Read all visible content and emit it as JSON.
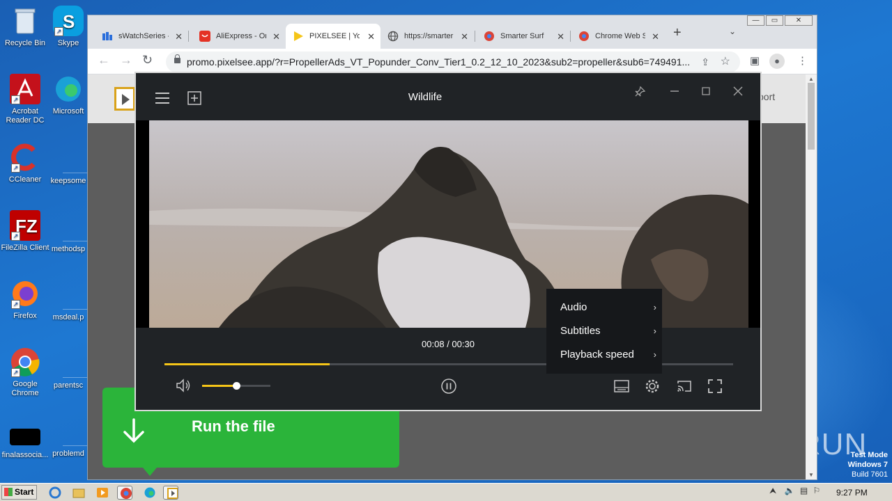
{
  "desktop": {
    "icons": [
      {
        "label": "Recycle Bin"
      },
      {
        "label": "Skype"
      },
      {
        "label": "Acrobat Reader DC"
      },
      {
        "label": "Microsoft"
      },
      {
        "label": "CCleaner"
      },
      {
        "label": "keepsome"
      },
      {
        "label": "FileZilla Client"
      },
      {
        "label": "methodsp"
      },
      {
        "label": "Firefox"
      },
      {
        "label": "msdeal.p"
      },
      {
        "label": "Google Chrome"
      },
      {
        "label": "parentsc"
      },
      {
        "label": "finalassocia..."
      },
      {
        "label": "problemd"
      }
    ],
    "watermark": "ANY RUN",
    "test_mode": [
      "Test Mode",
      "Windows 7",
      "Build 7601"
    ]
  },
  "browser": {
    "window_controls": {
      "minimize": "—",
      "restore": "▭",
      "close": "✕"
    },
    "tabs": [
      {
        "title": "sWatchSeries -",
        "close": "✕"
      },
      {
        "title": "AliExpress - On",
        "close": "✕"
      },
      {
        "title": "PIXELSEE | You",
        "close": "✕"
      },
      {
        "title": "https://smarter",
        "close": "✕"
      },
      {
        "title": "Smarter Surf",
        "close": "✕"
      },
      {
        "title": "Chrome Web S",
        "close": "✕"
      }
    ],
    "new_tab": "+",
    "tab_dropdown": "⌄",
    "nav": {
      "back": "←",
      "forward": "→",
      "reload": "↻"
    },
    "url": "promo.pixelsee.app/?r=PropellerAds_VT_Popunder_Conv_Tier1_0.2_12_10_2023&sub2=propeller&sub6=749491...",
    "page_header_link": "port"
  },
  "player": {
    "title": "Wildlife",
    "current_time": "00:08",
    "duration": "00:30",
    "time_display": "00:08 / 00:30",
    "progress_fraction": 0.29,
    "volume_fraction": 0.5,
    "settings_menu": [
      {
        "label": "Audio",
        "arrow": "›"
      },
      {
        "label": "Subtitles",
        "arrow": "›"
      },
      {
        "label": "Playback speed",
        "arrow": "›"
      }
    ]
  },
  "overlay": {
    "run_button_label": "Run the file"
  },
  "taskbar": {
    "start_label": "Start",
    "clock": "9:27 PM"
  },
  "colors": {
    "accent_yellow": "#f5c518",
    "run_green": "#2bb43a",
    "player_bg": "#202326"
  }
}
